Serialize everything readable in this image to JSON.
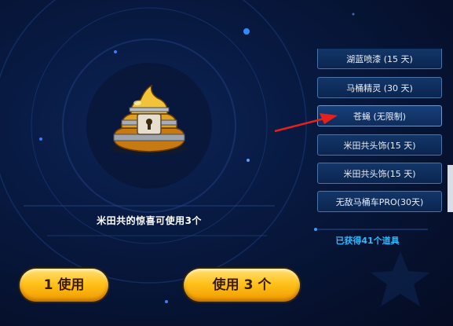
{
  "main": {
    "surprise_text": "米田共的惊喜可使用3个",
    "use_one_label": "1 使用",
    "use_all_label": "使用 3 个"
  },
  "items": [
    "湖蓝喷漆 (15 天)",
    "马桶精灵 (30 天)",
    "苍蝇 (无限制)",
    "米田共头饰(15 天)",
    "米田共头饰(15 天)",
    "无敌马桶车PRO(30天)"
  ],
  "list": {
    "obtained_text": "已获得41个道具"
  },
  "colors": {
    "button_gold": "#ffc21a",
    "list_border": "#4a73a8",
    "obtained_text": "#2fb7ff",
    "arrow": "#e8201c"
  }
}
